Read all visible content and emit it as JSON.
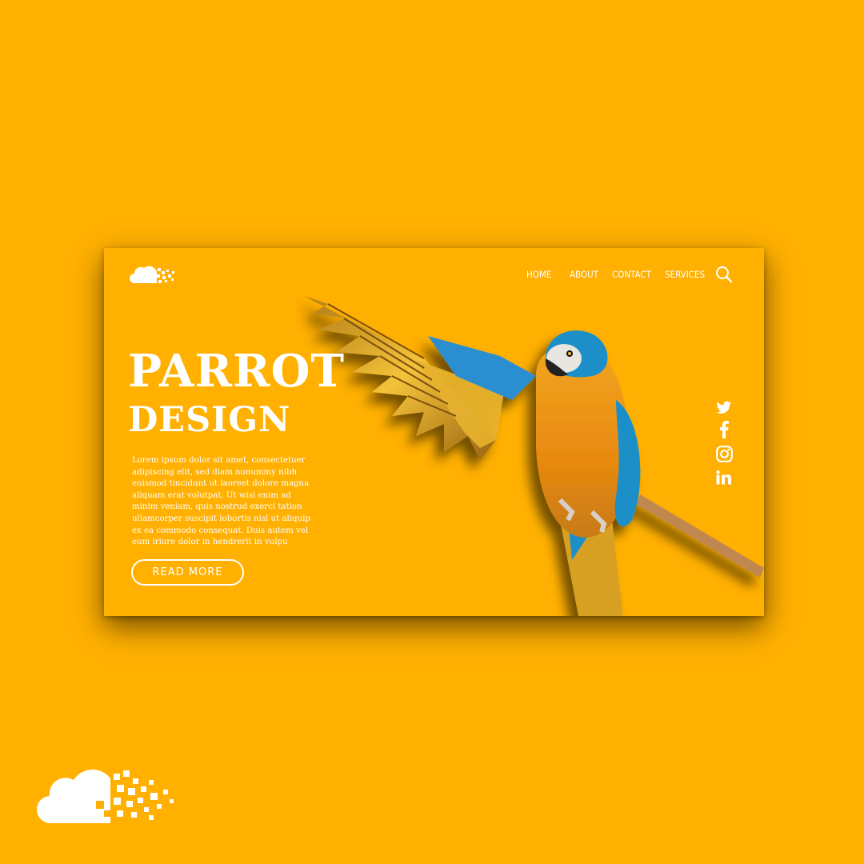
{
  "brand": {
    "logo": "cloud-pixel-logo"
  },
  "nav": {
    "items": [
      "HOME",
      "ABOUT",
      "CONTACT",
      "SERVICES"
    ],
    "search_icon": "search-icon"
  },
  "hero": {
    "title_line1": "PARROT",
    "title_line2": "DESIGN",
    "body": "Lorem ipsum dolor sit amet, consectetuer adipiscing elit, sed diam nonummy nibh euismod tincidunt ut laoreet dolore magna aliquam erat volutpat. Ut wisi enim ad minim veniam, quis nostrud exerci tation ullamcorper suscipit lobortis nisl ut aliquip ex ea commodo consequat. Duis autem vel eum iriure dolor in hendrerit in vulpu",
    "cta_label": "READ MORE",
    "image": "parrot-macaw-image"
  },
  "social": {
    "icons": [
      "twitter-icon",
      "facebook-icon",
      "instagram-icon",
      "linkedin-icon"
    ]
  },
  "colors": {
    "background": "#FFB000",
    "text": "#FFFFFF",
    "accent_blue": "#1E8FC8"
  }
}
